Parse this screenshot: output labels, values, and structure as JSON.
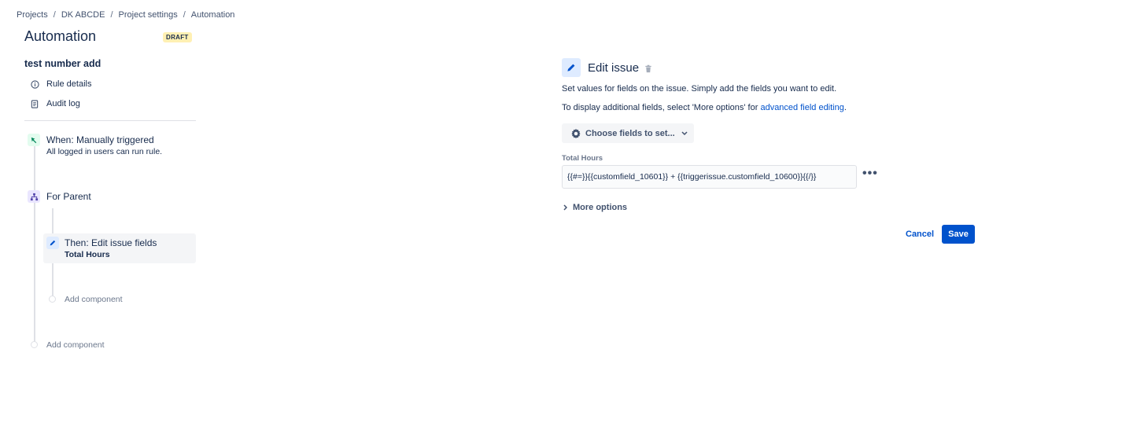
{
  "breadcrumb": [
    "Projects",
    "DK ABCDE",
    "Project settings",
    "Automation"
  ],
  "page": {
    "title": "Automation",
    "status_badge": "DRAFT"
  },
  "sidebar": {
    "rule_name": "test number add",
    "links": [
      {
        "label": "Rule details",
        "icon": "info-icon"
      },
      {
        "label": "Audit log",
        "icon": "document-icon"
      }
    ],
    "trigger": {
      "title": "When: Manually triggered",
      "subtitle": "All logged in users can run rule.",
      "icon": "trigger-icon"
    },
    "branch": {
      "title": "For Parent",
      "icon": "branch-icon"
    },
    "action": {
      "title": "Then: Edit issue fields",
      "subtitle": "Total Hours",
      "icon": "pencil-icon"
    },
    "add_component_inner": "Add component",
    "add_component_outer": "Add component"
  },
  "editor": {
    "title": "Edit issue",
    "description_1": "Set values for fields on the issue. Simply add the fields you want to edit.",
    "description_2_prefix": "To display additional fields, select 'More options' for ",
    "description_2_link": "advanced field editing",
    "description_2_suffix": ".",
    "choose_fields_label": "Choose fields to set...",
    "field_label": "Total Hours",
    "field_value": "{{#=}}{{customfield_10601}} + {{triggerissue.customfield_10600}}{{/}}",
    "more_options_label": "More options",
    "cancel_label": "Cancel",
    "save_label": "Save"
  },
  "colors": {
    "primary": "#0052cc",
    "draft_badge": "#fff0b3",
    "trigger_icon_bg": "#e3fcef",
    "branch_icon_bg": "#eae6ff",
    "action_icon_bg": "#deebff"
  }
}
